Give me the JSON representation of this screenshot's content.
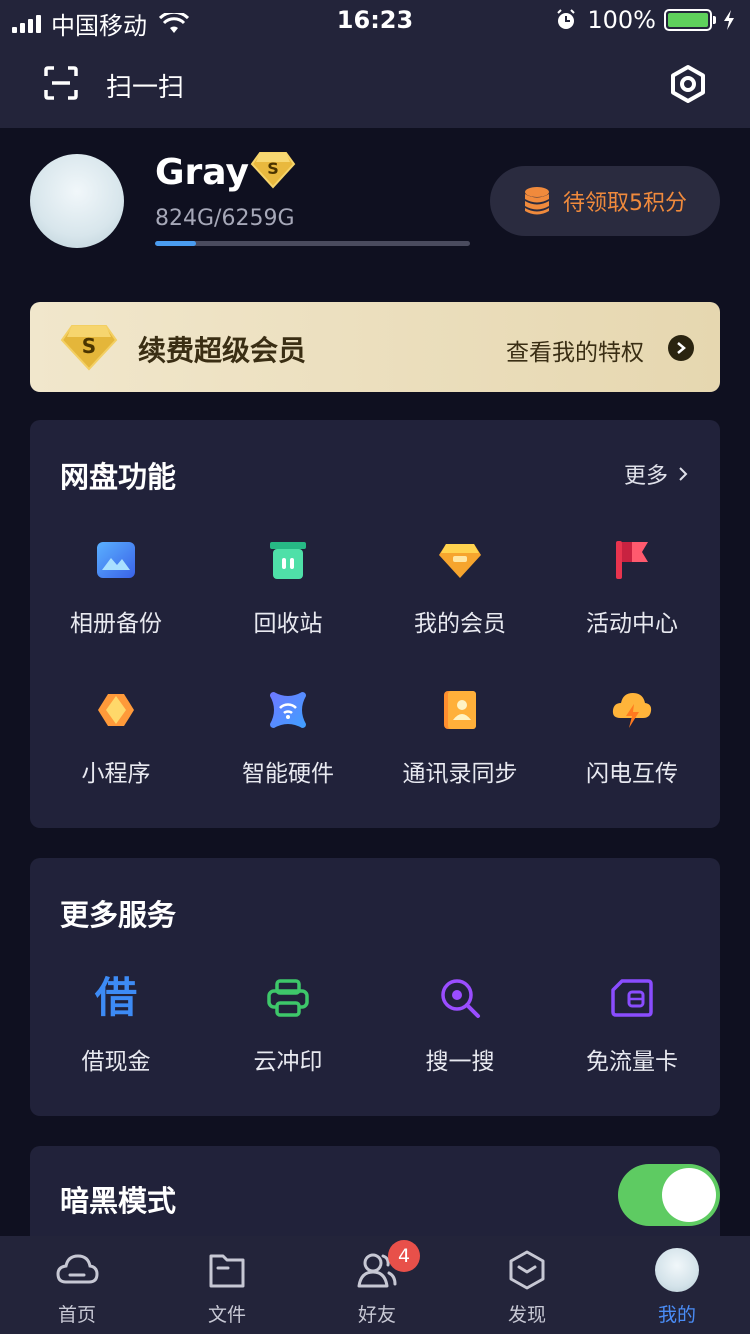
{
  "status_bar": {
    "carrier": "中国移动",
    "time": "16:23",
    "battery": "100%",
    "icons": [
      "signal-icon",
      "wifi-icon",
      "alarm-icon",
      "battery-icon",
      "charging-icon"
    ]
  },
  "top_bar": {
    "scan_label": "扫一扫",
    "icons": [
      "scan-icon",
      "settings-icon"
    ]
  },
  "profile": {
    "username": "Gray",
    "storage": "824G/6259G",
    "storage_used_fraction": 0.13,
    "points_label": "待领取5积分"
  },
  "vip_banner": {
    "title": "续费超级会员",
    "link": "查看我的特权"
  },
  "netdisk": {
    "title": "网盘功能",
    "more": "更多",
    "items": [
      {
        "label": "相册备份",
        "icon": "photo-backup-icon"
      },
      {
        "label": "回收站",
        "icon": "recycle-bin-icon"
      },
      {
        "label": "我的会员",
        "icon": "membership-icon"
      },
      {
        "label": "活动中心",
        "icon": "flag-icon"
      },
      {
        "label": "小程序",
        "icon": "mini-program-icon"
      },
      {
        "label": "智能硬件",
        "icon": "smart-hardware-icon"
      },
      {
        "label": "通讯录同步",
        "icon": "contacts-icon"
      },
      {
        "label": "闪电互传",
        "icon": "lightning-transfer-icon"
      }
    ]
  },
  "services": {
    "title": "更多服务",
    "items": [
      {
        "label": "借现金",
        "icon": "borrow-cash-icon",
        "glyph": "借"
      },
      {
        "label": "云冲印",
        "icon": "printer-icon"
      },
      {
        "label": "搜一搜",
        "icon": "search-icon"
      },
      {
        "label": "免流量卡",
        "icon": "sim-card-icon"
      }
    ]
  },
  "dark_mode": {
    "label": "暗黑模式",
    "enabled": true
  },
  "tab_bar": {
    "items": [
      {
        "label": "首页",
        "icon": "cloud-icon"
      },
      {
        "label": "文件",
        "icon": "folder-icon"
      },
      {
        "label": "好友",
        "icon": "friends-icon",
        "badge": "4"
      },
      {
        "label": "发现",
        "icon": "discover-icon"
      },
      {
        "label": "我的",
        "icon": "avatar"
      }
    ],
    "active_index": 4
  },
  "colors": {
    "background": "#0f1020",
    "card": "#21223a",
    "accent_blue": "#4a8cf5",
    "points_orange": "#f08a3c",
    "toggle_green": "#5ecb62",
    "vip_gold": "#e6d7b0",
    "badge_red": "#e8504a"
  }
}
